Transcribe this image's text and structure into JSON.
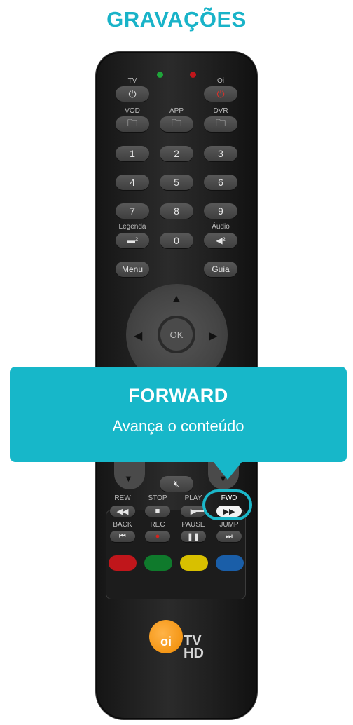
{
  "page": {
    "title": "GRAVAÇÕES"
  },
  "remote": {
    "top_labels": {
      "tv": "TV",
      "oi": "Oi",
      "vod": "VOD",
      "app": "APP",
      "dvr": "DVR"
    },
    "numbers": [
      "1",
      "2",
      "3",
      "4",
      "5",
      "6",
      "7",
      "8",
      "9",
      "0"
    ],
    "labels": {
      "legenda": "Legenda",
      "audio": "Áudio",
      "menu": "Menu",
      "guia": "Guia",
      "ok": "OK"
    },
    "playback": {
      "rew": "REW",
      "stop": "STOP",
      "play": "PLAY",
      "fwd": "FWD",
      "back": "BACK",
      "rec": "REC",
      "pause": "PAUSE",
      "jump": "JUMP"
    },
    "logo": {
      "brand": "oi",
      "line1": "TV",
      "line2": "HD"
    },
    "colors": {
      "red": "#c0161b",
      "green": "#0f7a2c",
      "yellow": "#d8c000",
      "blue": "#1a5ea8",
      "led_green": "#1fa53a",
      "led_red": "#c0161b"
    }
  },
  "tooltip": {
    "title": "FORWARD",
    "description": "Avança o conteúdo"
  },
  "accent": "#17b7c9"
}
